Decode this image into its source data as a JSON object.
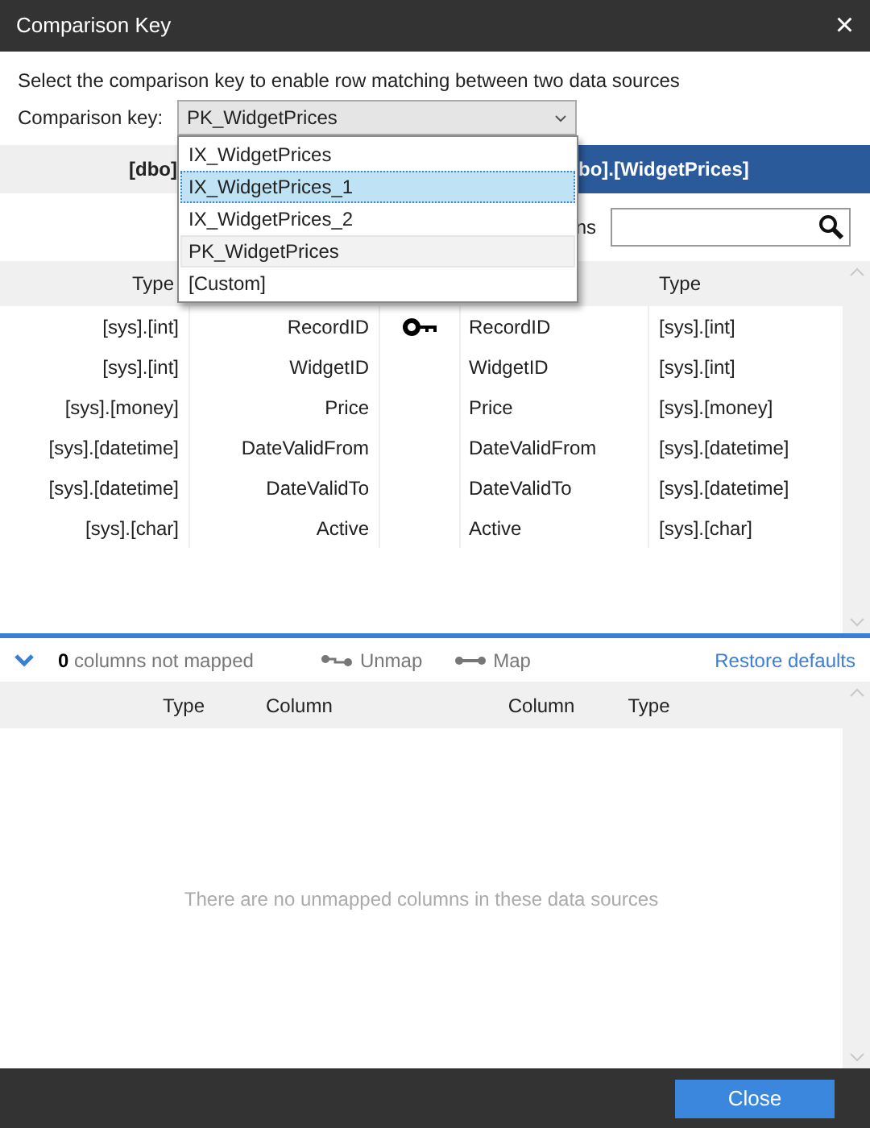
{
  "window": {
    "title": "Comparison Key",
    "close": "×"
  },
  "description": "Select the comparison key to enable row matching between two data sources",
  "comparison_key": {
    "label": "Comparison key:",
    "value": "PK_WidgetPrices",
    "expanded": true,
    "options": [
      {
        "label": "IX_WidgetPrices",
        "highlighted": false,
        "selected": false
      },
      {
        "label": "IX_WidgetPrices_1",
        "highlighted": true,
        "selected": false
      },
      {
        "label": "IX_WidgetPrices_2",
        "highlighted": false,
        "selected": false
      },
      {
        "label": "PK_WidgetPrices",
        "highlighted": false,
        "selected": true
      },
      {
        "label": "[Custom]",
        "highlighted": false,
        "selected": false
      }
    ]
  },
  "source_header": {
    "left": "[dbo]",
    "right": "bo].[WidgetPrices]"
  },
  "search": {
    "label": "ns"
  },
  "mapped_table": {
    "columns": [
      "Type",
      "Type"
    ],
    "rows": [
      {
        "left_type": "[sys].[int]",
        "left_column": "RecordID",
        "key": true,
        "right_column": "RecordID",
        "right_type": "[sys].[int]"
      },
      {
        "left_type": "[sys].[int]",
        "left_column": "WidgetID",
        "key": false,
        "right_column": "WidgetID",
        "right_type": "[sys].[int]"
      },
      {
        "left_type": "[sys].[money]",
        "left_column": "Price",
        "key": false,
        "right_column": "Price",
        "right_type": "[sys].[money]"
      },
      {
        "left_type": "[sys].[datetime]",
        "left_column": "DateValidFrom",
        "key": false,
        "right_column": "DateValidFrom",
        "right_type": "[sys].[datetime]"
      },
      {
        "left_type": "[sys].[datetime]",
        "left_column": "DateValidTo",
        "key": false,
        "right_column": "DateValidTo",
        "right_type": "[sys].[datetime]"
      },
      {
        "left_type": "[sys].[char]",
        "left_column": "Active",
        "key": false,
        "right_column": "Active",
        "right_type": "[sys].[char]"
      }
    ]
  },
  "unmapped_bar": {
    "count": "0",
    "label": "columns not mapped",
    "unmap": "Unmap",
    "map": "Map",
    "restore": "Restore defaults"
  },
  "unmapped_table": {
    "columns": [
      "Type",
      "Column",
      "Column",
      "Type"
    ],
    "empty_message": "There are no unmapped columns in these data sources"
  },
  "buttons": [
    "Close"
  ]
}
